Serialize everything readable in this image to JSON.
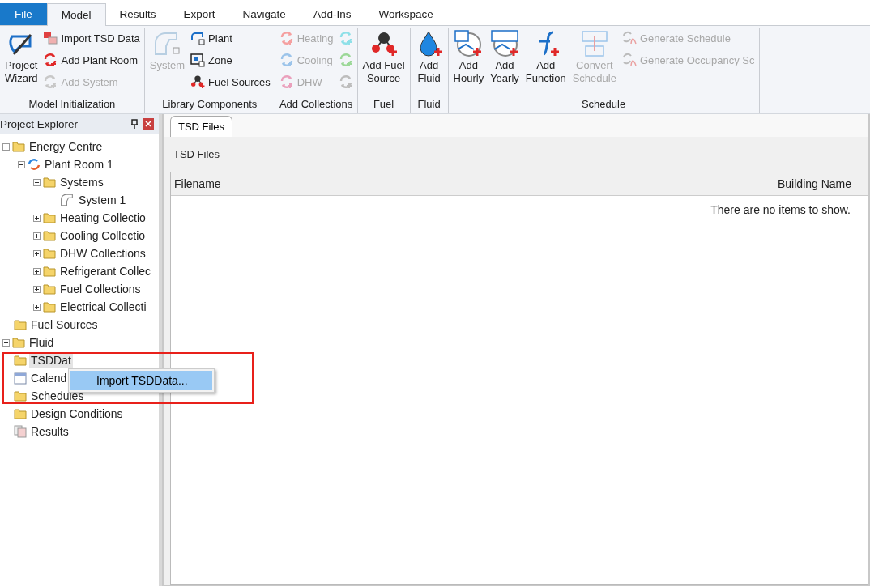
{
  "menu_tabs": [
    {
      "label": "File",
      "kind": "file",
      "selected": false
    },
    {
      "label": "Model",
      "kind": "tab",
      "selected": true
    },
    {
      "label": "Results",
      "kind": "tab",
      "selected": false
    },
    {
      "label": "Export",
      "kind": "tab",
      "selected": false
    },
    {
      "label": "Navigate",
      "kind": "tab",
      "selected": false
    },
    {
      "label": "Add-Ins",
      "kind": "tab",
      "selected": false
    },
    {
      "label": "Workspace",
      "kind": "tab",
      "selected": false
    }
  ],
  "ribbon": {
    "groups": [
      {
        "label": "Model Initialization",
        "items": [
          {
            "kind": "large",
            "label": "Project\nWizard",
            "disabled": false
          },
          {
            "kind": "stack",
            "items": [
              {
                "label": "Import TSD Data",
                "disabled": false
              },
              {
                "label": "Add Plant Room",
                "color": "#e02828",
                "disabled": false
              },
              {
                "label": "Add System",
                "color": "#c8c8c8",
                "disabled": true
              }
            ]
          }
        ]
      },
      {
        "label": "Library Components",
        "items": [
          {
            "kind": "large",
            "label": "System",
            "disabled": true
          },
          {
            "kind": "stack",
            "items": [
              {
                "label": "Plant",
                "disabled": false
              },
              {
                "label": "Zone",
                "disabled": false
              },
              {
                "label": "Fuel Sources",
                "disabled": false
              }
            ]
          }
        ]
      },
      {
        "label": "Add Collections",
        "items": [
          {
            "kind": "stack",
            "items": [
              {
                "label": "Heating",
                "color": "#f5a0a0",
                "disabled": true
              },
              {
                "label": "Cooling",
                "color": "#9cc4ea",
                "disabled": true
              },
              {
                "label": "DHW",
                "color": "#eaa0bc",
                "disabled": true
              }
            ]
          },
          {
            "kind": "stack",
            "items": [
              {
                "color": "#8ee0e8",
                "disabled": true
              },
              {
                "color": "#9cd898",
                "disabled": true
              },
              {
                "color": "#bdbdbd",
                "disabled": true
              }
            ]
          }
        ]
      },
      {
        "label": "Fuel",
        "items": [
          {
            "kind": "large",
            "label": "Add Fuel\nSource",
            "disabled": false
          }
        ]
      },
      {
        "label": "Fluid",
        "items": [
          {
            "kind": "large",
            "label": "Add\nFluid",
            "disabled": false
          }
        ]
      },
      {
        "label": "Schedule",
        "items": [
          {
            "kind": "large",
            "label": "Add\nHourly",
            "disabled": false
          },
          {
            "kind": "large",
            "label": "Add\nYearly",
            "disabled": false
          },
          {
            "kind": "large",
            "label": "Add\nFunction",
            "disabled": false
          },
          {
            "kind": "large",
            "label": "Convert\nSchedule",
            "disabled": true
          },
          {
            "kind": "stack",
            "items": [
              {
                "label": "Generate Schedule",
                "disabled": true
              },
              {
                "label": "Generate Occupancy Sc",
                "disabled": true
              }
            ]
          }
        ]
      }
    ]
  },
  "explorer": {
    "title": "Project Explorer",
    "tree": [
      {
        "label": "Energy Centre",
        "kind": "folder",
        "expanded": true,
        "selected": false,
        "children": [
          {
            "label": "Plant Room 1",
            "kind": "plant_room",
            "expanded": true,
            "selected": false,
            "children": [
              {
                "label": "Systems",
                "kind": "folder",
                "expanded": true,
                "selected": false,
                "children": [
                  {
                    "label": "System 1",
                    "kind": "system",
                    "selected": false
                  }
                ]
              },
              {
                "label": "Heating Collectio",
                "kind": "folder",
                "expanded": false,
                "selected": false
              },
              {
                "label": "Cooling Collectio",
                "kind": "folder",
                "expanded": false,
                "selected": false
              },
              {
                "label": "DHW Collections",
                "kind": "folder",
                "expanded": false,
                "selected": false
              },
              {
                "label": "Refrigerant Collec",
                "kind": "folder",
                "expanded": false,
                "selected": false
              },
              {
                "label": "Fuel Collections",
                "kind": "folder",
                "expanded": false,
                "selected": false
              },
              {
                "label": "Electrical Collecti",
                "kind": "folder",
                "expanded": false,
                "selected": false
              }
            ]
          }
        ]
      },
      {
        "label": "Fuel Sources",
        "kind": "folder",
        "selected": false
      },
      {
        "label": "Fluid",
        "kind": "folder",
        "expanded": false,
        "selected": false
      },
      {
        "label": "TSDDat",
        "kind": "folder",
        "selected": true
      },
      {
        "label": "Calend",
        "kind": "calendar",
        "selected": false
      },
      {
        "label": "Schedules",
        "kind": "folder",
        "selected": false
      },
      {
        "label": "Design Conditions",
        "kind": "folder",
        "selected": false
      },
      {
        "label": "Results",
        "kind": "results",
        "selected": false
      }
    ]
  },
  "context_menu": {
    "items": [
      "Import TSDData..."
    ]
  },
  "document": {
    "tab": "TSD Files",
    "heading": "TSD Files",
    "columns": [
      "Filename",
      "Building Name"
    ],
    "empty_message": "There are no items to show."
  }
}
